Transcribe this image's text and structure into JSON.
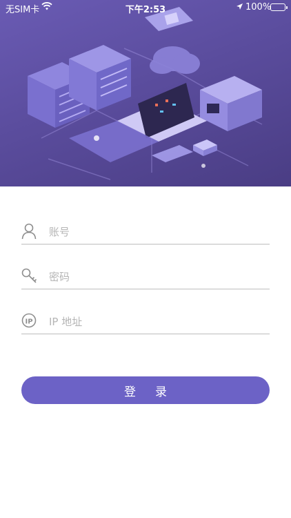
{
  "status_bar": {
    "carrier": "无SIM卡",
    "time": "下午2:53",
    "battery_percent": "100%",
    "battery_color": "#4cd964"
  },
  "hero": {
    "illustration": "server-network-isometric-illustration",
    "gradient_colors": [
      "#6a5bb4",
      "#4a3d84"
    ]
  },
  "form": {
    "account": {
      "icon": "user-icon",
      "placeholder": "账号",
      "value": ""
    },
    "password": {
      "icon": "key-icon",
      "placeholder": "密码",
      "value": ""
    },
    "ip": {
      "icon": "ip-icon",
      "placeholder": "IP 地址",
      "value": ""
    }
  },
  "login_button": {
    "label": "登录",
    "color": "#6c62c6"
  }
}
